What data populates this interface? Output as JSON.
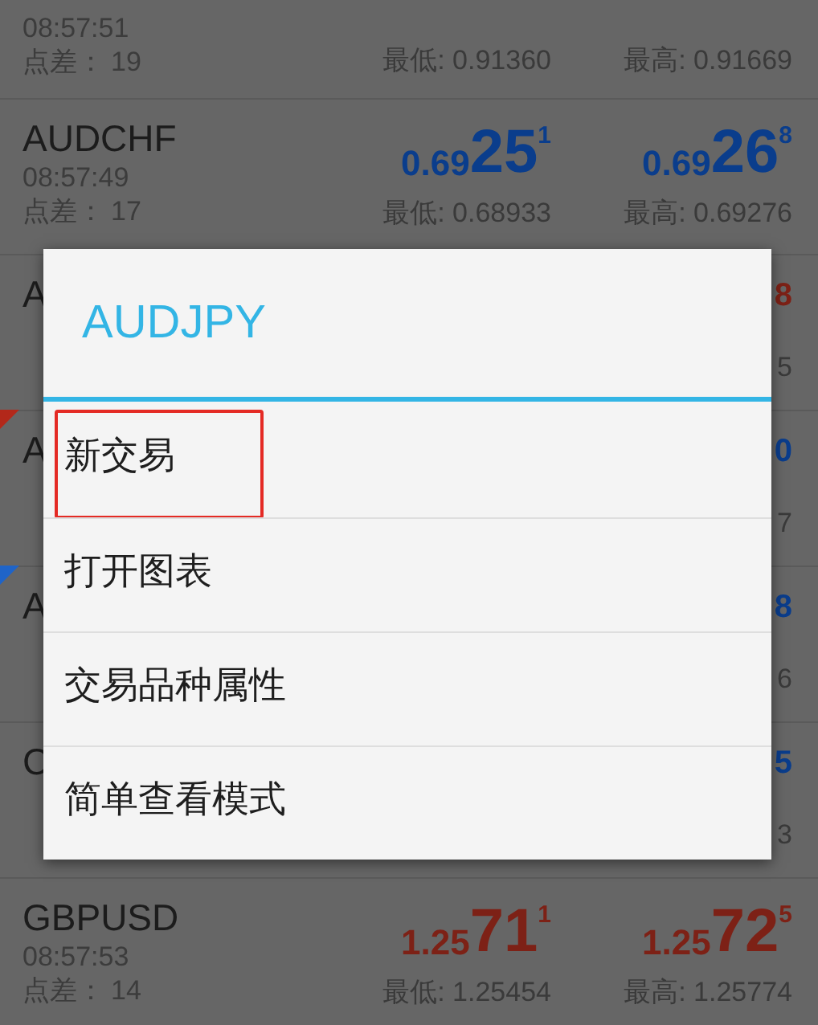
{
  "quotes": [
    {
      "kind": "full",
      "time": "08:57:51",
      "spread_label": "点差：",
      "spread": "19",
      "low": "最低: 0.91360",
      "high": "最高: 0.91669"
    },
    {
      "kind": "full",
      "name": "AUDCHF",
      "time": "08:57:49",
      "spread_label": "点差：",
      "spread": "17",
      "bid": {
        "prefix": "0.69",
        "main": "25",
        "sup": "1",
        "color": "#0a3d8c"
      },
      "ask": {
        "prefix": "0.69",
        "main": "26",
        "sup": "8",
        "color": "#0a3d8c"
      },
      "low": "最低: 0.68933",
      "high": "最高: 0.69276"
    },
    {
      "kind": "partial",
      "name": "A",
      "ask_fragment": {
        "text": "8",
        "color": "#7d2116"
      },
      "high_fragment": "5"
    },
    {
      "kind": "partial",
      "name": "A",
      "ask_fragment": {
        "text": "0",
        "color": "#0a3d8c"
      },
      "high_fragment": "7",
      "marker": {
        "color": "#b3281a"
      }
    },
    {
      "kind": "partial",
      "name": "A",
      "ask_fragment": {
        "text": "8",
        "color": "#0a3d8c"
      },
      "high_fragment": "6",
      "marker": {
        "color": "#1f64c8"
      }
    },
    {
      "kind": "partial",
      "name": "C",
      "ask_fragment": {
        "text": "5",
        "color": "#0a3d8c"
      },
      "high_fragment": "3"
    },
    {
      "kind": "full",
      "name": "GBPUSD",
      "time": "08:57:53",
      "spread_label": "点差：",
      "spread": "14",
      "bid": {
        "prefix": "1.25",
        "main": "71",
        "sup": "1",
        "color": "#7d2116"
      },
      "ask": {
        "prefix": "1.25",
        "main": "72",
        "sup": "5",
        "color": "#7d2116"
      },
      "low": "最低: 1.25454",
      "high": "最高: 1.25774"
    }
  ],
  "dialog": {
    "title": "AUDJPY",
    "items": [
      {
        "label": "新交易",
        "highlighted": true
      },
      {
        "label": "打开图表",
        "highlighted": false
      },
      {
        "label": "交易品种属性",
        "highlighted": false
      },
      {
        "label": "简单查看模式",
        "highlighted": false
      }
    ]
  }
}
